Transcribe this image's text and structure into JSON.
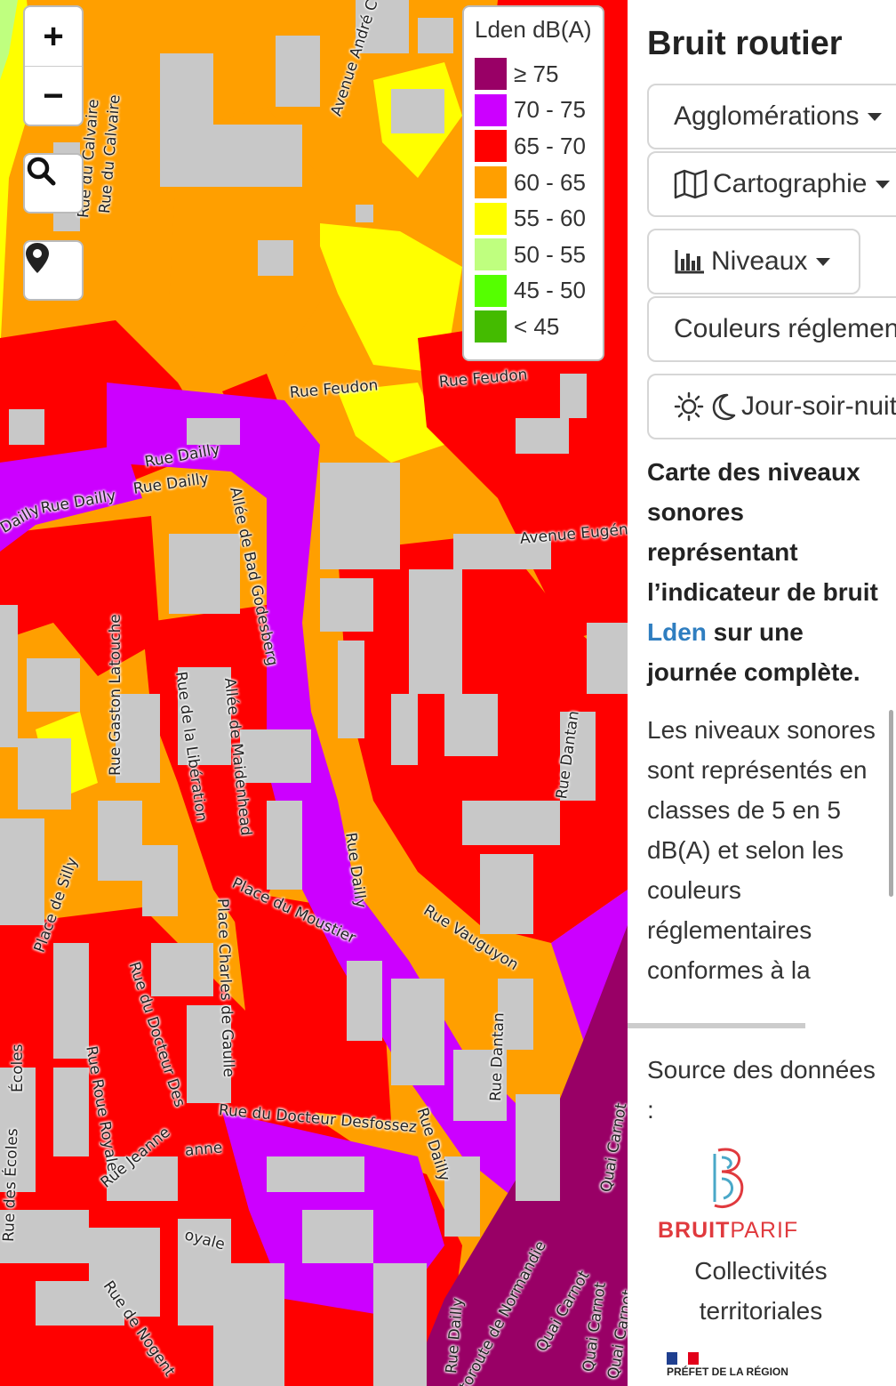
{
  "map": {
    "zoom_in_label": "+",
    "zoom_out_label": "−",
    "icons": {
      "search": "search-icon",
      "locate": "map-marker-icon"
    },
    "legend": {
      "title": "Lden dB(A)",
      "items": [
        {
          "label": "≥ 75",
          "color": "#990066"
        },
        {
          "label": "70 - 75",
          "color": "#cc00ff"
        },
        {
          "label": "65 - 70",
          "color": "#ff0000"
        },
        {
          "label": "60 - 65",
          "color": "#ff9f00"
        },
        {
          "label": "55 - 60",
          "color": "#ffff00"
        },
        {
          "label": "50 - 55",
          "color": "#bfff7f"
        },
        {
          "label": "45 - 50",
          "color": "#55ff00"
        },
        {
          "label": "< 45",
          "color": "#44bb00"
        }
      ]
    },
    "streets": [
      "Rue du Calvaire",
      "Rue du Calvaire",
      "Avenue André C",
      "Rue Feudon",
      "Rue Feudon",
      "Rue Dailly",
      "Rue Dailly",
      "Rue Dailly",
      "Dailly",
      "Allée de Bad Godesberg",
      "Avenue Eugéni",
      "Rue Gaston Latouche",
      "Rue de la Libération",
      "Allée de Maidenhead",
      "Rue Dantan",
      "Rue Dailly",
      "Place du Moustier",
      "Rue Vauguyon",
      "Place de Silly",
      "Place Charles de Gaulle",
      "Rue du Docteur Des",
      "Écoles",
      "Rue Roue Royale",
      "Rue du Docteur Desfossez",
      "Rue Dantan",
      "Rue Dailly",
      "Rue Jeanne",
      "anne",
      "Rue des Écoles",
      "oyale",
      "Rue de Nogent",
      "Rue Dailly",
      "toroute de Normandie",
      "Quai Carnot",
      "Quai Carnot",
      "Quai Carnot",
      "Quai Carnot"
    ]
  },
  "panel": {
    "title": "Bruit routier",
    "buttons": {
      "agglomerations": "Agglomérations",
      "cartographie": "Cartographie",
      "niveaux": "Niveaux",
      "couleurs": "Couleurs réglementaires",
      "periode": "Jour-soir-nuit"
    },
    "icons": {
      "map": "map-icon",
      "chart": "bar-chart-icon",
      "sun": "sun-icon",
      "moon": "moon-icon"
    },
    "description": {
      "part1": "Carte des niveaux sonores représentant l’indicateur de bruit ",
      "link": "Lden",
      "part2": " sur une journée complète."
    },
    "description2": "Les niveaux sonores sont représentés en classes de 5 en 5 dB(A) et selon les couleurs réglementaires conformes à la",
    "source_label": "Source des données :",
    "bruitparif": {
      "part1": "BRUIT",
      "part2": "PARIF",
      "color1": "#e03a3e",
      "color2": "#e03a3e"
    },
    "collectivites": "Collectivités territoriales",
    "prefet_text": "PRÉFET DE LA RÉGION"
  }
}
